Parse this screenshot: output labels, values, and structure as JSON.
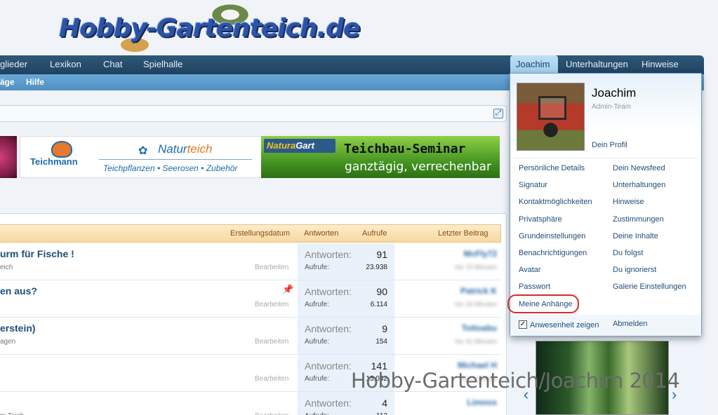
{
  "site": {
    "logo_text": "Hobby-Gartenteich.de"
  },
  "nav": {
    "left_tabs": [
      "glieder",
      "Lexikon",
      "Chat",
      "Spielhalle"
    ],
    "right_tabs": [
      "Joachim",
      "Unterhaltungen",
      "Hinweise"
    ],
    "sub_tabs": [
      "äge",
      "Hilfe"
    ]
  },
  "banners": {
    "teichmann": "Teichmann",
    "naturteich_pre": "Natur",
    "naturteich_post": "teich",
    "naturteich_sub": "Teichpflanzen • Seerosen • Zubehör",
    "naturagart_brand_1": "Natura",
    "naturagart_brand_2": "Gart",
    "naturagart_title": "Teichbau-Seminar",
    "naturagart_sub": "ganztägig, verrechenbar"
  },
  "table": {
    "headers": {
      "created": "Erstellungsdatum",
      "replies": "Antworten",
      "views": "Aufrufe",
      "last": "Letzter Beitrag"
    },
    "replies_label": "Antworten:",
    "views_label": "Aufrufe:",
    "edit_label": "Bearbeiten",
    "rows": [
      {
        "title": "urm für Fische !",
        "sub": "eich",
        "replies": "91",
        "views": "23.938",
        "last_user": "McFly72",
        "last_date": "Vor 15 Minuten",
        "pinned": false
      },
      {
        "title": "en aus?",
        "sub": "",
        "replies": "90",
        "views": "6.114",
        "last_user": "Patrick K",
        "last_date": "Vor 29 Minuten",
        "pinned": true
      },
      {
        "title": "erstein)",
        "sub": "agen",
        "replies": "9",
        "views": "154",
        "last_user": "Tottoabu",
        "last_date": "Vor 41 Minuten",
        "pinned": false
      },
      {
        "title": "",
        "sub": "",
        "replies": "141",
        "views": "15.042",
        "last_user": "Michael H",
        "last_date": "Vor 1 Stunde",
        "pinned": false
      },
      {
        "title": "",
        "sub": "m Teich",
        "replies": "4",
        "views": "112",
        "last_user": "Limnos",
        "last_date": "",
        "pinned": false
      }
    ]
  },
  "dropdown": {
    "username": "Joachim",
    "role": "Admin-Team",
    "profile_link": "Dein Profil",
    "left_items": [
      "Persönliche Details",
      "Signatur",
      "Kontaktmöglichkeiten",
      "Privatsphäre",
      "Grundeinstellungen",
      "Benachrichtigungen",
      "Avatar",
      "Passwort",
      "Meine Anhänge"
    ],
    "right_items": [
      "Dein Newsfeed",
      "Unterhaltungen",
      "Hinweise",
      "Zustimmungen",
      "Deine Inhalte",
      "Du folgst",
      "Du ignorierst",
      "Galerie Einstellungen"
    ],
    "presence_label": "Anwesenheit zeigen",
    "presence_checked": true,
    "logout": "Abmelden",
    "highlight_color": "#d52b2b"
  },
  "watermark": "Hobby-Gartenteich/Joachim 2014",
  "icons": {
    "expand": "expand-icon",
    "pin": "pin-icon",
    "carousel_prev": "chevron-left-icon",
    "carousel_next": "chevron-right-icon"
  }
}
